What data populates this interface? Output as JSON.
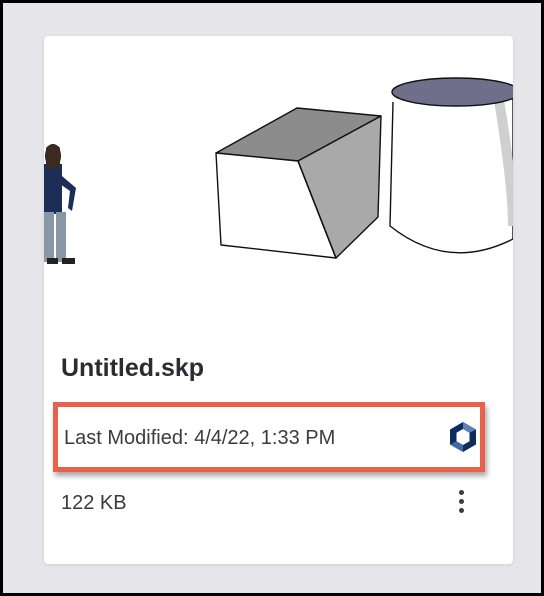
{
  "file": {
    "name": "Untitled.skp",
    "modified": "Last Modified: 4/4/22, 1:33 PM",
    "size": "122 KB"
  },
  "icons": {
    "sync": "trimble-connect-icon",
    "menu": "more-vertical-icon"
  },
  "colors": {
    "highlight": "#e8614c",
    "brand": "#0e2d5e"
  }
}
